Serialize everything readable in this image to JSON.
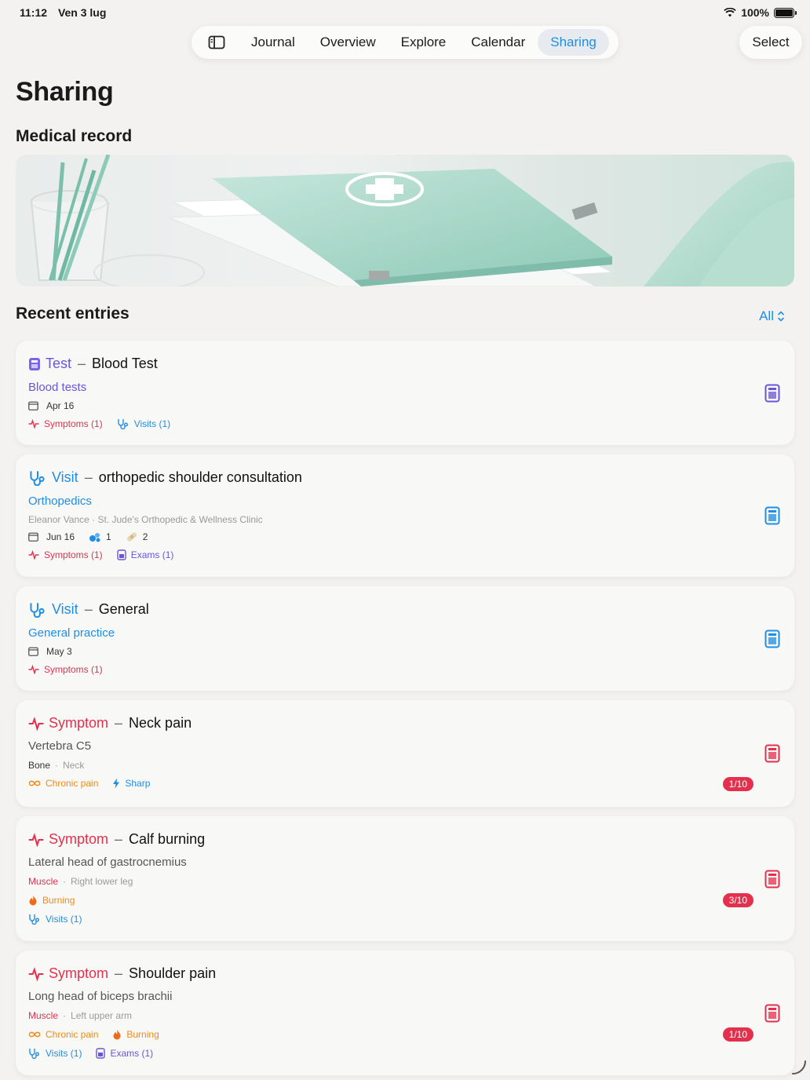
{
  "status": {
    "time": "11:12",
    "date": "Ven 3 lug",
    "battery": "100%"
  },
  "tabs": [
    "Journal",
    "Overview",
    "Explore",
    "Calendar",
    "Sharing"
  ],
  "active_tab": "Sharing",
  "select_label": "Select",
  "page_title": "Sharing",
  "medical_record_title": "Medical record",
  "recent_title": "Recent entries",
  "filter_label": "All",
  "colors": {
    "accent": "#1e8ee6",
    "symptom": "#e5304d",
    "test": "#6b55d8",
    "chronic": "#ef8a18"
  },
  "entries": [
    {
      "type": "Test",
      "dash": "–",
      "name": "Blood Test",
      "category": "Blood tests",
      "date": "Apr 16",
      "links": {
        "symptoms": "Symptoms (1)",
        "visits": "Visits (1)"
      }
    },
    {
      "type": "Visit",
      "dash": "–",
      "name": "orthopedic shoulder consultation",
      "category": "Orthopedics",
      "detail": "Eleanor Vance · St. Jude's Orthopedic & Wellness Clinic",
      "date": "Jun 16",
      "meds": "1",
      "bandages": "2",
      "links": {
        "symptoms": "Symptoms (1)",
        "exams": "Exams (1)"
      }
    },
    {
      "type": "Visit",
      "dash": "–",
      "name": "General",
      "category": "General practice",
      "date": "May 3",
      "links": {
        "symptoms": "Symptoms (1)"
      }
    },
    {
      "type": "Symptom",
      "dash": "–",
      "name": "Neck pain",
      "location": "Vertebra C5",
      "tissue": "Bone",
      "sep": "·",
      "region": "Neck",
      "tags": {
        "chronic": "Chronic pain",
        "quality": "Sharp"
      },
      "severity": "1/10"
    },
    {
      "type": "Symptom",
      "dash": "–",
      "name": "Calf burning",
      "location": "Lateral head of gastrocnemius",
      "tissue": "Muscle",
      "sep": "·",
      "region": "Right lower leg",
      "tags": {
        "quality": "Burning"
      },
      "links": {
        "visits": "Visits (1)"
      },
      "severity": "3/10"
    },
    {
      "type": "Symptom",
      "dash": "–",
      "name": "Shoulder pain",
      "location": "Long head of biceps brachii",
      "tissue": "Muscle",
      "sep": "·",
      "region": "Left upper arm",
      "tags": {
        "chronic": "Chronic pain",
        "quality": "Burning"
      },
      "links": {
        "visits": "Visits (1)",
        "exams": "Exams (1)"
      },
      "severity": "1/10"
    }
  ]
}
